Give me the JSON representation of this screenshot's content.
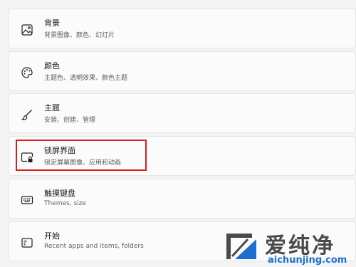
{
  "settings_items": [
    {
      "icon": "picture-icon",
      "title": "背景",
      "subtitle": "背景图像、颜色、幻灯片"
    },
    {
      "icon": "palette-icon",
      "title": "颜色",
      "subtitle": "主题色、透明效果、颜色主题"
    },
    {
      "icon": "brush-icon",
      "title": "主题",
      "subtitle": "安装、创建、管理"
    },
    {
      "icon": "lock-screen-icon",
      "title": "锁屏界面",
      "subtitle": "锁定屏幕图像、应用和动画"
    },
    {
      "icon": "keyboard-icon",
      "title": "触摸键盘",
      "subtitle": "Themes, size"
    },
    {
      "icon": "start-menu-icon",
      "title": "开始",
      "subtitle": "Recent apps and items, folders"
    }
  ],
  "highlight_color": "#d41f1f",
  "watermark": {
    "brand": "爱纯净",
    "domain": "aichunjing.com"
  }
}
